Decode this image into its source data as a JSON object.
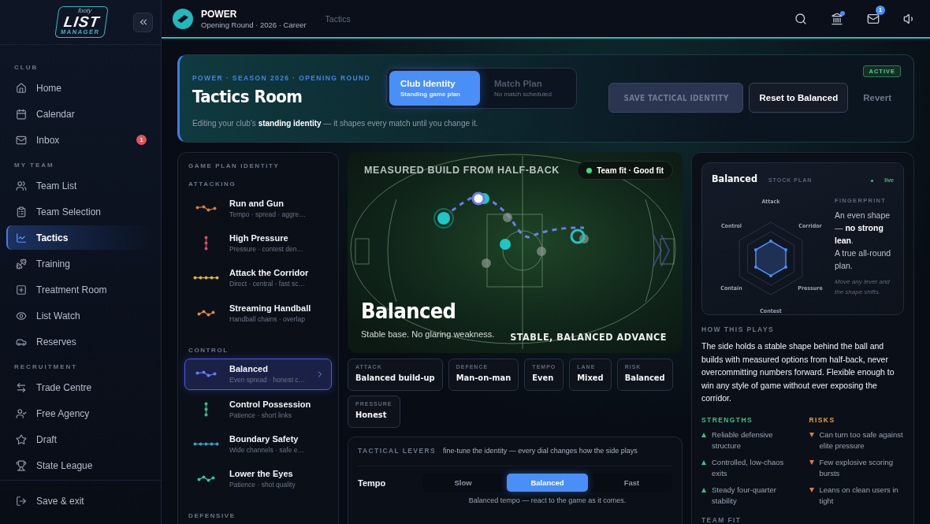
{
  "sidebar": {
    "logo": {
      "small": "footy",
      "word": "LIST",
      "sub": "MANAGER"
    },
    "sections": [
      {
        "title": "CLUB",
        "items": [
          {
            "label": "Home",
            "selected": false
          },
          {
            "label": "Calendar",
            "selected": false
          },
          {
            "label": "Inbox",
            "selected": false,
            "badge": "1"
          }
        ]
      },
      {
        "title": "MY TEAM",
        "items": [
          {
            "label": "Team List",
            "selected": false
          },
          {
            "label": "Team Selection",
            "selected": false
          },
          {
            "label": "Tactics",
            "selected": true
          },
          {
            "label": "Training",
            "selected": false
          },
          {
            "label": "Treatment Room",
            "selected": false
          },
          {
            "label": "List Watch",
            "selected": false
          },
          {
            "label": "Reserves",
            "selected": false
          }
        ]
      },
      {
        "title": "RECRUITMENT",
        "items": [
          {
            "label": "Trade Centre",
            "selected": false
          },
          {
            "label": "Free Agency",
            "selected": false
          },
          {
            "label": "Draft",
            "selected": false
          },
          {
            "label": "State League",
            "selected": false
          }
        ]
      }
    ],
    "footer": "Save & exit"
  },
  "topbar": {
    "club": "POWER",
    "subtitle": "Opening Round · 2026 · Career",
    "breadcrumb": "Tactics",
    "bank_alert": true,
    "mail_badge": "1"
  },
  "hero": {
    "eyebrow": "POWER · SEASON 2026 · OPENING ROUND",
    "title": "Tactics Room",
    "note": "Editing your club's **standing identity** — it shapes every match until you change it.",
    "modes": [
      {
        "label": "Club Identity",
        "sub": "Standing game plan",
        "selected": true
      },
      {
        "label": "Match Plan",
        "sub": "No match scheduled",
        "selected": false
      }
    ],
    "save": {
      "label": "SAVE TACTICAL IDENTITY",
      "disabled": true
    },
    "reset": "Reset to Balanced",
    "revert": "Revert",
    "status": "ACTIVE"
  },
  "plans": {
    "title": "GAME PLAN IDENTITY",
    "groups": [
      {
        "title": "ATTACKING",
        "items": [
          {
            "name": "Run and Gun",
            "desc": "Tempo · spread · aggre…",
            "color": "#e0773a",
            "selected": false
          },
          {
            "name": "High Pressure",
            "desc": "Pressure · contest den…",
            "color": "#e0456a",
            "selected": false
          },
          {
            "name": "Attack the Corridor",
            "desc": "Direct · central · fast sc…",
            "color": "#e0b43a",
            "selected": false
          },
          {
            "name": "Streaming Handball",
            "desc": "Handball chains · overlap",
            "color": "#e08a3a",
            "selected": false
          }
        ]
      },
      {
        "title": "CONTROL",
        "items": [
          {
            "name": "Balanced",
            "desc": "Even spread · honest c…",
            "color": "#6b7cf5",
            "selected": true
          },
          {
            "name": "Control Possession",
            "desc": "Patience · short links",
            "color": "#2fbf8a",
            "selected": false
          },
          {
            "name": "Boundary Safety",
            "desc": "Wide channels · safe e…",
            "color": "#3a9ec4",
            "selected": false
          },
          {
            "name": "Lower the Eyes",
            "desc": "Patience · shot quality",
            "color": "#3abf9a",
            "selected": false
          }
        ]
      },
      {
        "title": "DEFENSIVE"
      }
    ]
  },
  "pitch": {
    "title": "MEASURED BUILD FROM HALF-BACK",
    "fit": {
      "label": "Team fit · Good fit"
    },
    "plan": "Balanced",
    "tagline": "Stable base. No glaring weakness.",
    "motto": "STABLE, BALANCED ADVANCE"
  },
  "traits": [
    {
      "label": "ATTACK",
      "value": "Balanced build-up"
    },
    {
      "label": "DEFENCE",
      "value": "Man-on-man"
    },
    {
      "label": "TEMPO",
      "value": "Even"
    },
    {
      "label": "LANE",
      "value": "Mixed"
    },
    {
      "label": "RISK",
      "value": "Balanced"
    },
    {
      "label": "PRESSURE",
      "value": "Honest"
    }
  ],
  "levers": {
    "title": "TACTICAL LEVERS",
    "hint": "fine-tune the identity — every dial changes how the side plays",
    "rows": [
      {
        "name": "Tempo",
        "options": [
          {
            "label": "Slow",
            "selected": false
          },
          {
            "label": "Balanced",
            "selected": true
          },
          {
            "label": "Fast",
            "selected": false
          }
        ],
        "note": "Balanced tempo — react to the game as it comes."
      }
    ]
  },
  "profile": {
    "name": "Balanced",
    "tag": "STOCK PLAN",
    "live": "live",
    "axes": [
      "Attack",
      "Corridor",
      "Pressure",
      "Contest",
      "Contain",
      "Control"
    ],
    "fingerprint_title": "FINGERPRINT",
    "fingerprint": "An even shape — **no strong lean**.",
    "fingerprint_more": "A true all-round plan.",
    "hint": "Move any lever and the shape shifts.",
    "how_title": "HOW THIS PLAYS",
    "how": "The side holds a stable shape behind the ball and builds with measured options from half-back, never overcommitting numbers forward. Flexible enough to win any style of game without ever exposing the corridor.",
    "strengths_title": "STRENGTHS",
    "strengths": [
      "Reliable defensive structure",
      "Controlled, low-chaos exits",
      "Steady four-quarter stability"
    ],
    "risks_title": "RISKS",
    "risks": [
      "Can turn too safe against elite pressure",
      "Few explosive scoring bursts",
      "Leans on clean users in tight"
    ],
    "fit_title": "TEAM FIT"
  }
}
